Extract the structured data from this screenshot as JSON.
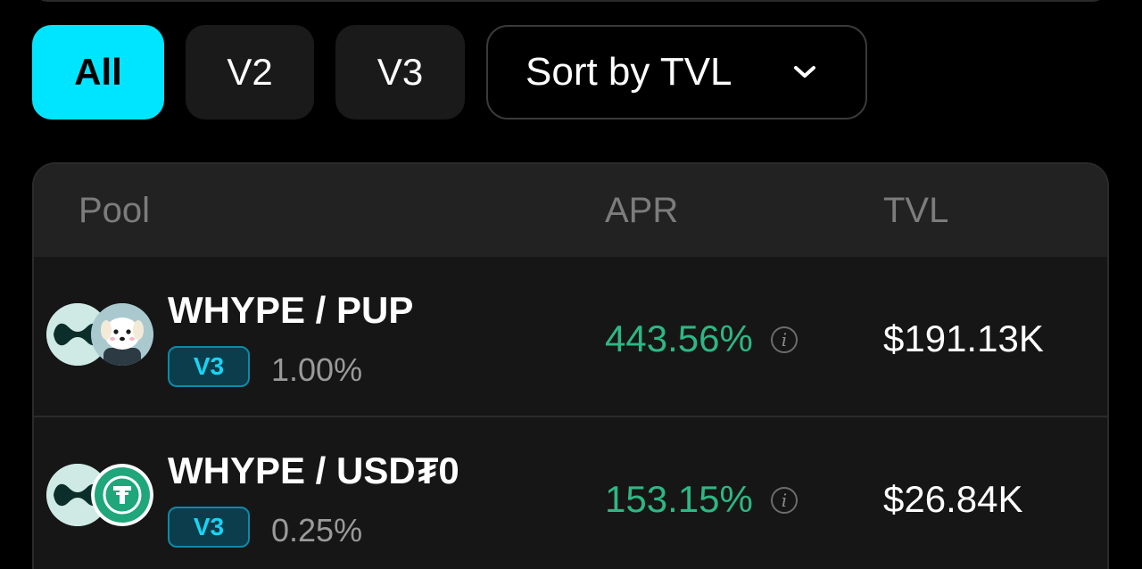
{
  "filters": {
    "items": [
      {
        "label": "All",
        "active": true
      },
      {
        "label": "V2",
        "active": false
      },
      {
        "label": "V3",
        "active": false
      }
    ],
    "sort_label": "Sort by TVL"
  },
  "table": {
    "headers": {
      "pool": "Pool",
      "apr": "APR",
      "tvl": "TVL"
    },
    "rows": [
      {
        "pair": "WHYPE / PUP",
        "version": "V3",
        "fee": "1.00%",
        "apr": "443.56%",
        "tvl": "$191.13K",
        "token_a_icon": "hype-icon",
        "token_b_icon": "pup-icon"
      },
      {
        "pair": "WHYPE / USD₮0",
        "version": "V3",
        "fee": "0.25%",
        "apr": "153.15%",
        "tvl": "$26.84K",
        "token_a_icon": "hype-icon",
        "token_b_icon": "usdt0-icon"
      }
    ]
  },
  "colors": {
    "accent": "#00e5ff",
    "apr_green": "#2db784",
    "badge_text": "#18d4f4",
    "badge_bg": "#0c3d4c",
    "background": "#000000",
    "card": "#1c1c1c"
  }
}
